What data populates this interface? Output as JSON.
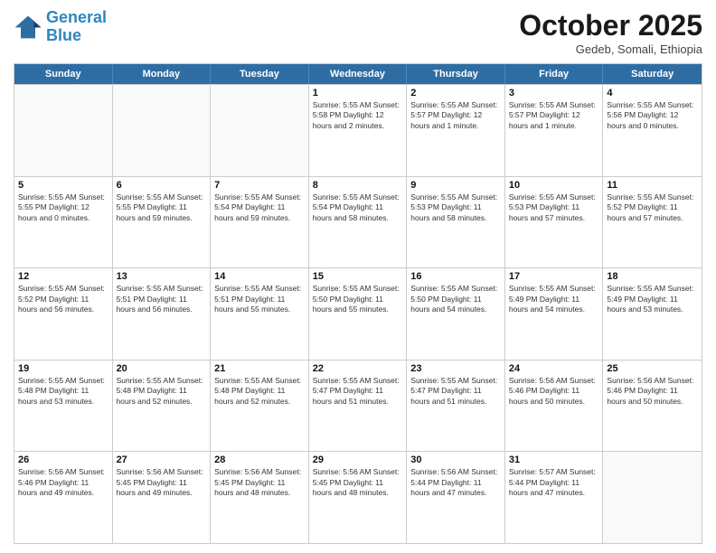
{
  "logo": {
    "line1": "General",
    "line2": "Blue"
  },
  "header": {
    "month": "October 2025",
    "location": "Gedeb, Somali, Ethiopia"
  },
  "weekdays": [
    "Sunday",
    "Monday",
    "Tuesday",
    "Wednesday",
    "Thursday",
    "Friday",
    "Saturday"
  ],
  "rows": [
    [
      {
        "day": "",
        "info": ""
      },
      {
        "day": "",
        "info": ""
      },
      {
        "day": "",
        "info": ""
      },
      {
        "day": "1",
        "info": "Sunrise: 5:55 AM\nSunset: 5:58 PM\nDaylight: 12 hours\nand 2 minutes."
      },
      {
        "day": "2",
        "info": "Sunrise: 5:55 AM\nSunset: 5:57 PM\nDaylight: 12 hours\nand 1 minute."
      },
      {
        "day": "3",
        "info": "Sunrise: 5:55 AM\nSunset: 5:57 PM\nDaylight: 12 hours\nand 1 minute."
      },
      {
        "day": "4",
        "info": "Sunrise: 5:55 AM\nSunset: 5:56 PM\nDaylight: 12 hours\nand 0 minutes."
      }
    ],
    [
      {
        "day": "5",
        "info": "Sunrise: 5:55 AM\nSunset: 5:55 PM\nDaylight: 12 hours\nand 0 minutes."
      },
      {
        "day": "6",
        "info": "Sunrise: 5:55 AM\nSunset: 5:55 PM\nDaylight: 11 hours\nand 59 minutes."
      },
      {
        "day": "7",
        "info": "Sunrise: 5:55 AM\nSunset: 5:54 PM\nDaylight: 11 hours\nand 59 minutes."
      },
      {
        "day": "8",
        "info": "Sunrise: 5:55 AM\nSunset: 5:54 PM\nDaylight: 11 hours\nand 58 minutes."
      },
      {
        "day": "9",
        "info": "Sunrise: 5:55 AM\nSunset: 5:53 PM\nDaylight: 11 hours\nand 58 minutes."
      },
      {
        "day": "10",
        "info": "Sunrise: 5:55 AM\nSunset: 5:53 PM\nDaylight: 11 hours\nand 57 minutes."
      },
      {
        "day": "11",
        "info": "Sunrise: 5:55 AM\nSunset: 5:52 PM\nDaylight: 11 hours\nand 57 minutes."
      }
    ],
    [
      {
        "day": "12",
        "info": "Sunrise: 5:55 AM\nSunset: 5:52 PM\nDaylight: 11 hours\nand 56 minutes."
      },
      {
        "day": "13",
        "info": "Sunrise: 5:55 AM\nSunset: 5:51 PM\nDaylight: 11 hours\nand 56 minutes."
      },
      {
        "day": "14",
        "info": "Sunrise: 5:55 AM\nSunset: 5:51 PM\nDaylight: 11 hours\nand 55 minutes."
      },
      {
        "day": "15",
        "info": "Sunrise: 5:55 AM\nSunset: 5:50 PM\nDaylight: 11 hours\nand 55 minutes."
      },
      {
        "day": "16",
        "info": "Sunrise: 5:55 AM\nSunset: 5:50 PM\nDaylight: 11 hours\nand 54 minutes."
      },
      {
        "day": "17",
        "info": "Sunrise: 5:55 AM\nSunset: 5:49 PM\nDaylight: 11 hours\nand 54 minutes."
      },
      {
        "day": "18",
        "info": "Sunrise: 5:55 AM\nSunset: 5:49 PM\nDaylight: 11 hours\nand 53 minutes."
      }
    ],
    [
      {
        "day": "19",
        "info": "Sunrise: 5:55 AM\nSunset: 5:48 PM\nDaylight: 11 hours\nand 53 minutes."
      },
      {
        "day": "20",
        "info": "Sunrise: 5:55 AM\nSunset: 5:48 PM\nDaylight: 11 hours\nand 52 minutes."
      },
      {
        "day": "21",
        "info": "Sunrise: 5:55 AM\nSunset: 5:48 PM\nDaylight: 11 hours\nand 52 minutes."
      },
      {
        "day": "22",
        "info": "Sunrise: 5:55 AM\nSunset: 5:47 PM\nDaylight: 11 hours\nand 51 minutes."
      },
      {
        "day": "23",
        "info": "Sunrise: 5:55 AM\nSunset: 5:47 PM\nDaylight: 11 hours\nand 51 minutes."
      },
      {
        "day": "24",
        "info": "Sunrise: 5:56 AM\nSunset: 5:46 PM\nDaylight: 11 hours\nand 50 minutes."
      },
      {
        "day": "25",
        "info": "Sunrise: 5:56 AM\nSunset: 5:46 PM\nDaylight: 11 hours\nand 50 minutes."
      }
    ],
    [
      {
        "day": "26",
        "info": "Sunrise: 5:56 AM\nSunset: 5:46 PM\nDaylight: 11 hours\nand 49 minutes."
      },
      {
        "day": "27",
        "info": "Sunrise: 5:56 AM\nSunset: 5:45 PM\nDaylight: 11 hours\nand 49 minutes."
      },
      {
        "day": "28",
        "info": "Sunrise: 5:56 AM\nSunset: 5:45 PM\nDaylight: 11 hours\nand 48 minutes."
      },
      {
        "day": "29",
        "info": "Sunrise: 5:56 AM\nSunset: 5:45 PM\nDaylight: 11 hours\nand 48 minutes."
      },
      {
        "day": "30",
        "info": "Sunrise: 5:56 AM\nSunset: 5:44 PM\nDaylight: 11 hours\nand 47 minutes."
      },
      {
        "day": "31",
        "info": "Sunrise: 5:57 AM\nSunset: 5:44 PM\nDaylight: 11 hours\nand 47 minutes."
      },
      {
        "day": "",
        "info": ""
      }
    ]
  ]
}
